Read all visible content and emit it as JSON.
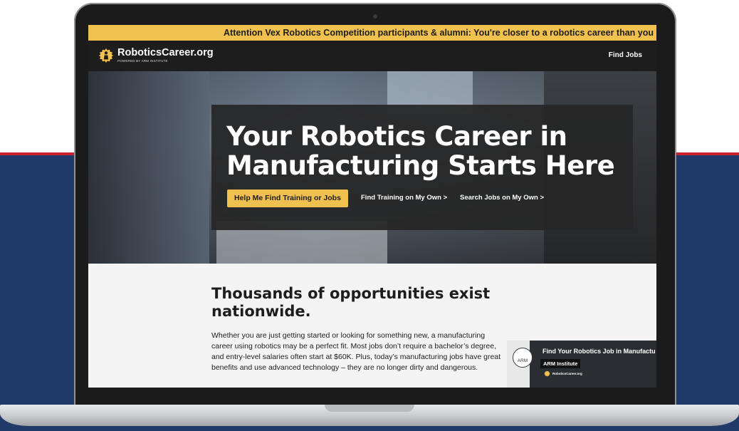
{
  "banner": {
    "text": "Attention Vex Robotics Competition participants & alumni: You're closer to a robotics career than you migh"
  },
  "brand": {
    "name": "RoboticsCareer.org",
    "tagline": "POWERED BY ARM INSTITUTE"
  },
  "nav": {
    "find_jobs": "Find Jobs"
  },
  "hero": {
    "title_line1": "Your Robotics Career in",
    "title_line2": "Manufacturing Starts Here",
    "primary_button": "Help Me Find Training or Jobs",
    "link1": "Find Training on My Own >",
    "link2": "Search Jobs on My Own >"
  },
  "section": {
    "heading": "Thousands of opportunities exist nationwide.",
    "paragraph": "Whether you are just getting started or looking for something new, a manufacturing career using robotics may be a perfect fit. Most jobs don’t require a bachelor’s degree, and entry-level salaries often start at $60K. Plus, today’s manufacturing jobs have great benefits and use advanced technology – they are no longer dirty and dangerous."
  },
  "video": {
    "badge": "ARM",
    "title": "Find Your Robotics Job in Manufactu",
    "channel": "ARM Institute",
    "thumb_brand": "RoboticsCareer.org"
  },
  "colors": {
    "accent": "#f1c14f",
    "nav": "#1d1d1d",
    "navy": "#1f3a68",
    "red": "#c8232c"
  }
}
